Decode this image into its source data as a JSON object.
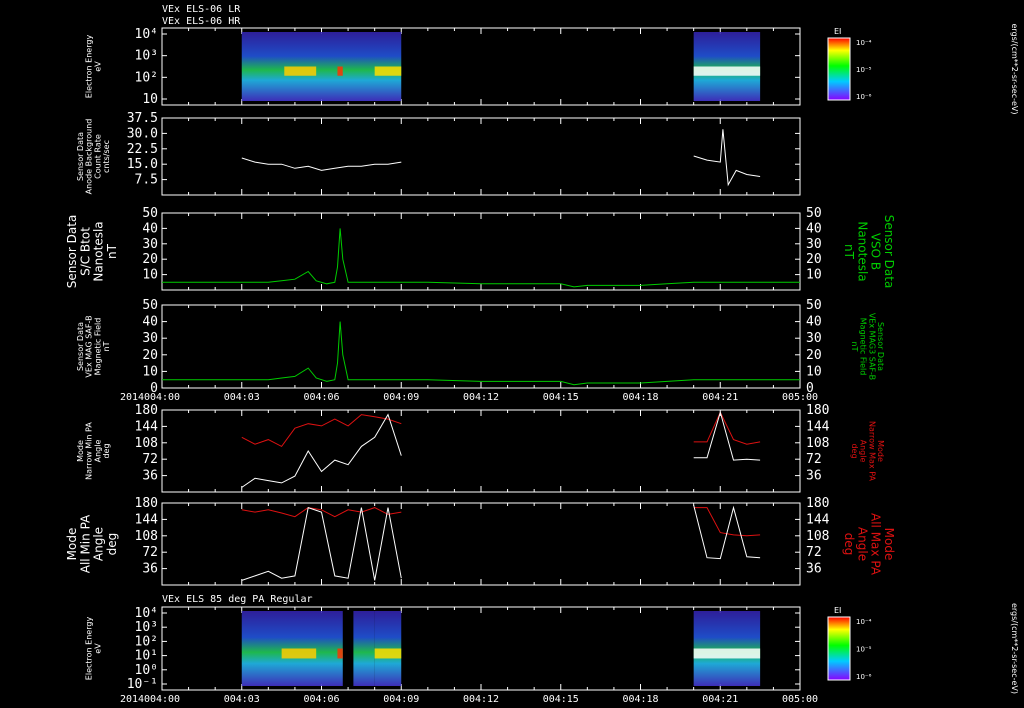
{
  "header": {
    "line1": "VEx ELS-06 LR",
    "line2": "VEx ELS-06 HR",
    "panel7_title": "VEx ELS 85 deg PA Regular"
  },
  "time_axis": {
    "year": "2014",
    "ticks": [
      "004:00",
      "004:03",
      "004:06",
      "004:09",
      "004:12",
      "004:15",
      "004:18",
      "004:21",
      "005:00"
    ]
  },
  "colors": {
    "white": "#ffffff",
    "green": "#00cc00",
    "red": "#dd1111",
    "axis": "#ffffff"
  },
  "colorbar": {
    "title": "EI",
    "ticks": [
      "10⁻⁴",
      "10⁻⁵",
      "10⁻⁶"
    ],
    "unit": "ergs/(cm**2-sr-sec-eV)"
  },
  "panels": [
    {
      "id": "p1",
      "type": "spectrogram",
      "left_label": [
        "Electron Energy",
        "eV"
      ],
      "yticks": [
        "10⁴",
        "10³",
        "10²",
        "10"
      ],
      "log": true
    },
    {
      "id": "p2",
      "type": "line",
      "left_label": [
        "Sensor Data",
        "Anode Background",
        "Count Rate",
        "cnts/sec"
      ],
      "yticks": [
        "37.5",
        "30.0",
        "22.5",
        "15.0",
        "7.5"
      ],
      "ylim": [
        0,
        37.5
      ]
    },
    {
      "id": "p3",
      "type": "line",
      "left_label": [
        "Sensor Data",
        "S/C Btot",
        "Nanotesla",
        "nT"
      ],
      "right_label": [
        "Sensor Data",
        "VSO B",
        "Nanotesla",
        "nT"
      ],
      "yticks": [
        "50",
        "40",
        "30",
        "20",
        "10"
      ],
      "ylim": [
        0,
        50
      ]
    },
    {
      "id": "p4",
      "type": "line",
      "left_label": [
        "Sensor Data",
        "VEx MAG SAF-B",
        "Magnetic Field",
        "nT"
      ],
      "right_label": [
        "Sensor Data",
        "VEx MAG3 SAF-B",
        "Magnetic Field",
        "nT"
      ],
      "yticks": [
        "50",
        "40",
        "30",
        "20",
        "10",
        "0"
      ],
      "ylim": [
        0,
        50
      ]
    },
    {
      "id": "p5",
      "type": "line",
      "left_label": [
        "Mode",
        "Narrow Min PA",
        "Angle",
        "deg"
      ],
      "right_label": [
        "Mode",
        "Narrow Max PA",
        "Angle",
        "deg"
      ],
      "yticks": [
        "180",
        "144",
        "108",
        "72",
        "36"
      ],
      "ylim": [
        0,
        180
      ]
    },
    {
      "id": "p6",
      "type": "line",
      "left_label": [
        "Mode",
        "All Min PA",
        "Angle",
        "deg"
      ],
      "right_label": [
        "Mode",
        "All Max PA",
        "Angle",
        "deg"
      ],
      "yticks": [
        "180",
        "144",
        "108",
        "72",
        "36"
      ],
      "ylim": [
        0,
        180
      ]
    },
    {
      "id": "p7",
      "type": "spectrogram",
      "left_label": [
        "Electron Energy",
        "eV"
      ],
      "yticks": [
        "10⁴",
        "10³",
        "10²",
        "10¹",
        "10⁰",
        "10⁻¹"
      ],
      "log": true
    }
  ],
  "chart_data": {
    "type": "line",
    "x_unit": "day-of-year hh:mm",
    "x_range": [
      "004:00",
      "005:00"
    ],
    "series": [
      {
        "name": "Anode Background Count Rate",
        "panel": "p2",
        "color": "#ffffff",
        "segments": [
          {
            "x": [
              3.0,
              3.5,
              4.0,
              4.5,
              5.0,
              5.5,
              6.0,
              6.5,
              7.0,
              7.5,
              8.0,
              8.5,
              9.0
            ],
            "y": [
              18,
              16,
              15,
              15,
              13,
              14,
              12,
              13,
              14,
              14,
              15,
              15,
              16
            ]
          },
          {
            "x": [
              20.0,
              20.5,
              21.0,
              21.1,
              21.3,
              21.6,
              22.0,
              22.5
            ],
            "y": [
              19,
              17,
              16,
              32,
              5,
              12,
              10,
              9
            ]
          }
        ]
      },
      {
        "name": "S/C Btot",
        "panel": "p3",
        "color": "#00cc00",
        "segments": [
          {
            "x": [
              0,
              1,
              2,
              3,
              4,
              4.5,
              5,
              5.5,
              5.8,
              6.2,
              6.5,
              6.6,
              6.7,
              6.8,
              7,
              8,
              9,
              10,
              12,
              15,
              15.5,
              16,
              18,
              19,
              20,
              22,
              24
            ],
            "y": [
              5,
              5,
              5,
              5,
              5,
              6,
              7,
              12,
              6,
              4,
              5,
              15,
              40,
              20,
              5,
              5,
              5,
              5,
              4,
              4,
              2,
              3,
              3,
              4,
              5,
              5,
              5
            ]
          }
        ]
      },
      {
        "name": "VEx MAG SAF-B",
        "panel": "p4",
        "color": "#00cc00",
        "segments": [
          {
            "x": [
              0,
              1,
              2,
              3,
              4,
              4.5,
              5,
              5.5,
              5.8,
              6.2,
              6.5,
              6.6,
              6.7,
              6.8,
              7,
              8,
              9,
              10,
              12,
              15,
              15.5,
              16,
              18,
              19,
              20,
              22,
              24
            ],
            "y": [
              5,
              5,
              5,
              5,
              5,
              6,
              7,
              12,
              6,
              4,
              5,
              15,
              40,
              20,
              5,
              5,
              5,
              5,
              4,
              4,
              2,
              3,
              3,
              4,
              5,
              5,
              5
            ]
          }
        ]
      },
      {
        "name": "Narrow Max PA",
        "panel": "p5",
        "color": "#dd1111",
        "segments": [
          {
            "x": [
              3.0,
              3.5,
              4.0,
              4.5,
              5.0,
              5.5,
              6.0,
              6.5,
              7.0,
              7.5,
              8.0,
              8.5,
              9.0
            ],
            "y": [
              120,
              105,
              115,
              100,
              140,
              150,
              145,
              160,
              145,
              170,
              165,
              160,
              150
            ]
          },
          {
            "x": [
              20.0,
              20.5,
              21.0,
              21.5,
              22.0,
              22.5
            ],
            "y": [
              110,
              110,
              175,
              115,
              105,
              110
            ]
          }
        ]
      },
      {
        "name": "Narrow Min PA",
        "panel": "p5",
        "color": "#ffffff",
        "segments": [
          {
            "x": [
              3.0,
              3.5,
              4.0,
              4.5,
              5.0,
              5.5,
              6.0,
              6.5,
              7.0,
              7.5,
              8.0,
              8.5,
              9.0
            ],
            "y": [
              10,
              30,
              25,
              20,
              35,
              90,
              45,
              70,
              60,
              100,
              120,
              170,
              80
            ]
          },
          {
            "x": [
              20.0,
              20.5,
              21.0,
              21.5,
              22.0,
              22.5
            ],
            "y": [
              75,
              75,
              175,
              70,
              72,
              70
            ]
          }
        ]
      },
      {
        "name": "All Max PA",
        "panel": "p6",
        "color": "#dd1111",
        "segments": [
          {
            "x": [
              3.0,
              3.5,
              4.0,
              4.5,
              5.0,
              5.5,
              6.0,
              6.5,
              7.0,
              7.5,
              8.0,
              8.5,
              9.0
            ],
            "y": [
              165,
              160,
              165,
              158,
              150,
              170,
              165,
              150,
              165,
              160,
              170,
              155,
              160
            ]
          },
          {
            "x": [
              20.0,
              20.5,
              21.0,
              21.5,
              22.0,
              22.5
            ],
            "y": [
              170,
              170,
              115,
              110,
              108,
              110
            ]
          }
        ]
      },
      {
        "name": "All Min PA",
        "panel": "p6",
        "color": "#ffffff",
        "segments": [
          {
            "x": [
              3.0,
              3.5,
              4.0,
              4.5,
              5.0,
              5.5,
              6.0,
              6.5,
              7.0,
              7.5,
              8.0,
              8.5,
              9.0
            ],
            "y": [
              10,
              20,
              30,
              15,
              20,
              170,
              160,
              20,
              15,
              170,
              10,
              170,
              15
            ]
          },
          {
            "x": [
              20.0,
              20.5,
              21.0,
              21.5,
              22.0,
              22.5
            ],
            "y": [
              175,
              60,
              58,
              170,
              62,
              60
            ]
          }
        ]
      }
    ]
  }
}
